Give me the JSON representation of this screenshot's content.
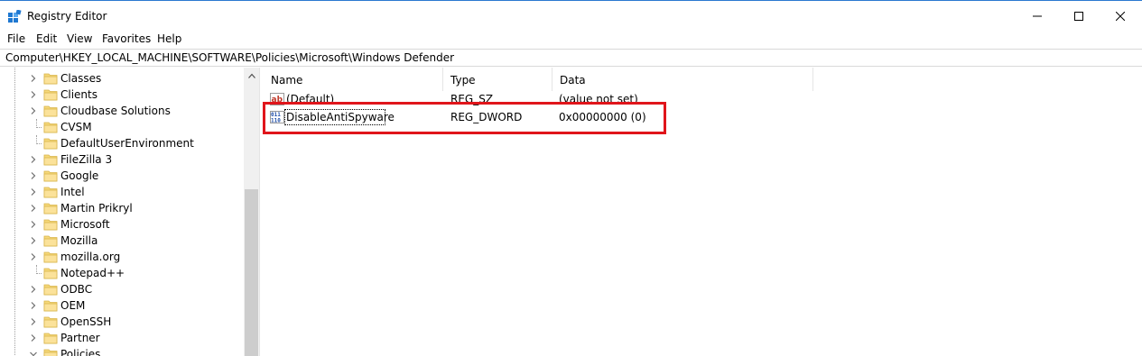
{
  "window": {
    "title": "Registry Editor",
    "accent_color": "#2b79d0"
  },
  "menu": {
    "items": [
      "File",
      "Edit",
      "View",
      "Favorites",
      "Help"
    ]
  },
  "address": {
    "path": "Computer\\HKEY_LOCAL_MACHINE\\SOFTWARE\\Policies\\Microsoft\\Windows Defender"
  },
  "tree": {
    "items": [
      {
        "label": "Classes",
        "expand": "collapsed"
      },
      {
        "label": "Clients",
        "expand": "collapsed"
      },
      {
        "label": "Cloudbase Solutions",
        "expand": "collapsed"
      },
      {
        "label": "CVSM",
        "expand": "none"
      },
      {
        "label": "DefaultUserEnvironment",
        "expand": "none"
      },
      {
        "label": "FileZilla 3",
        "expand": "collapsed"
      },
      {
        "label": "Google",
        "expand": "collapsed"
      },
      {
        "label": "Intel",
        "expand": "collapsed"
      },
      {
        "label": "Martin Prikryl",
        "expand": "collapsed"
      },
      {
        "label": "Microsoft",
        "expand": "collapsed"
      },
      {
        "label": "Mozilla",
        "expand": "collapsed"
      },
      {
        "label": "mozilla.org",
        "expand": "collapsed"
      },
      {
        "label": "Notepad++",
        "expand": "none"
      },
      {
        "label": "ODBC",
        "expand": "collapsed"
      },
      {
        "label": "OEM",
        "expand": "collapsed"
      },
      {
        "label": "OpenSSH",
        "expand": "collapsed"
      },
      {
        "label": "Partner",
        "expand": "collapsed"
      },
      {
        "label": "Policies",
        "expand": "expanded"
      }
    ]
  },
  "list": {
    "headers": {
      "name": "Name",
      "type": "Type",
      "data": "Data"
    },
    "rows": [
      {
        "name": "(Default)",
        "type": "REG_SZ",
        "data": "(value not set)",
        "icon": "string-value-icon"
      },
      {
        "name": "DisableAntiSpyware",
        "type": "REG_DWORD",
        "data": "0x00000000 (0)",
        "icon": "binary-value-icon"
      }
    ]
  },
  "annotation": {
    "color": "#e0151b"
  },
  "folder_color": "#f5d87a"
}
